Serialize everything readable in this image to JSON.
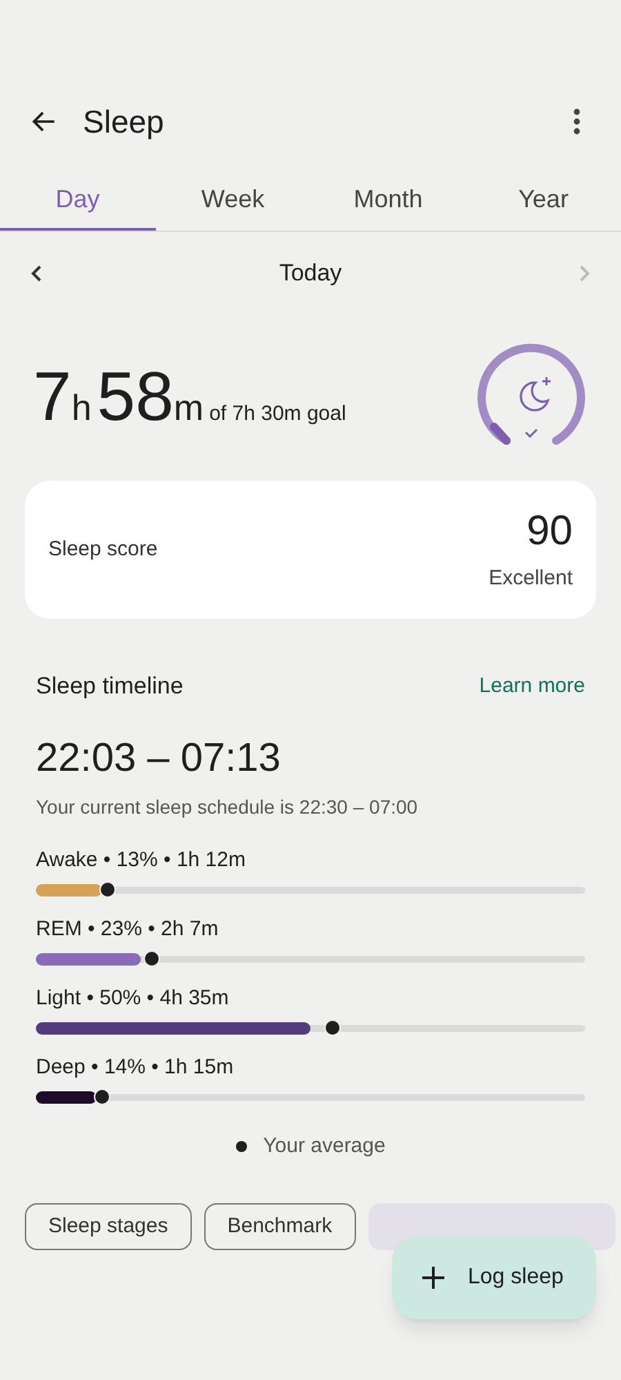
{
  "header": {
    "title": "Sleep"
  },
  "tabs": [
    {
      "label": "Day",
      "selected": true
    },
    {
      "label": "Week",
      "selected": false
    },
    {
      "label": "Month",
      "selected": false
    },
    {
      "label": "Year",
      "selected": false
    }
  ],
  "date_nav": {
    "label": "Today",
    "next_disabled": true
  },
  "summary": {
    "hours": "7",
    "hours_unit": "h",
    "minutes": "58",
    "minutes_unit": "m",
    "goal": "of 7h 30m goal",
    "goal_met": true
  },
  "score_card": {
    "label": "Sleep score",
    "value": "90",
    "rating": "Excellent"
  },
  "timeline": {
    "title": "Sleep timeline",
    "link": "Learn more",
    "range": "22:03 – 07:13",
    "schedule": "Your current sleep schedule is 22:30 – 07:00"
  },
  "stages": [
    {
      "label": "Awake • 13% • 1h 12m",
      "color": "#d4a356",
      "level": 0.12,
      "average": {
        "level": 0.13
      }
    },
    {
      "label": "REM • 23% • 2h 7m",
      "color": "#8a6bb5",
      "level": 0.19,
      "average": {
        "level": 0.21
      }
    },
    {
      "label": "Light • 50% • 4h 35m",
      "color": "#553c7d",
      "level": 0.5,
      "average": {
        "level": 0.54
      }
    },
    {
      "label": "Deep • 14% • 1h 15m",
      "color": "#1c0b2b",
      "level": 0.11,
      "average": {
        "level": 0.12
      }
    }
  ],
  "legend": "Your average",
  "chips": [
    "Sleep stages",
    "Benchmark"
  ],
  "fab": {
    "label": "Log sleep"
  }
}
